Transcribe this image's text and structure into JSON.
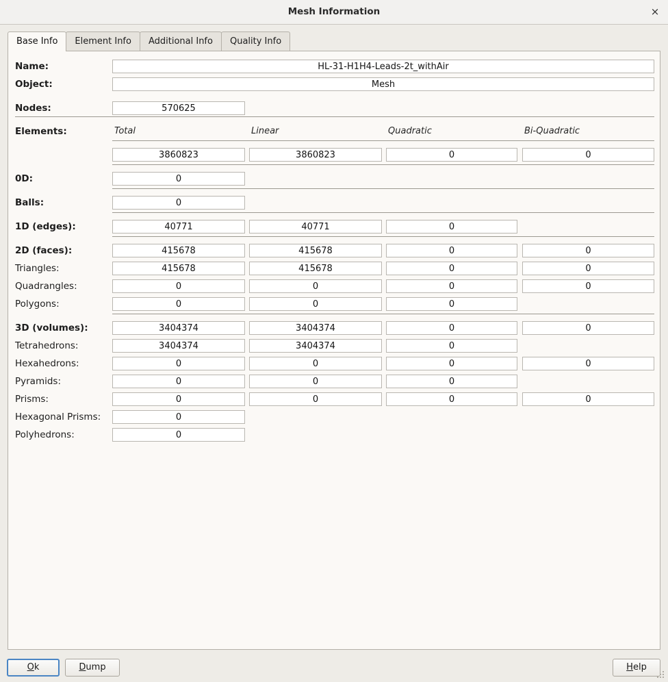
{
  "window": {
    "title": "Mesh Information",
    "close_icon": "close-icon",
    "close_glyph": "×"
  },
  "tabs": [
    {
      "label": "Base Info",
      "active": true
    },
    {
      "label": "Element Info",
      "active": false
    },
    {
      "label": "Additional Info",
      "active": false
    },
    {
      "label": "Quality Info",
      "active": false
    }
  ],
  "base_info": {
    "name_label": "Name:",
    "name_value": "HL-31-H1H4-Leads-2t_withAir",
    "object_label": "Object:",
    "object_value": "Mesh",
    "nodes_label": "Nodes:",
    "nodes_value": "570625",
    "elements_label": "Elements:",
    "columns": [
      "Total",
      "Linear",
      "Quadratic",
      "Bi-Quadratic"
    ],
    "rows": [
      {
        "label": "",
        "bold": true,
        "values": [
          "3860823",
          "3860823",
          "0",
          "0"
        ]
      },
      {
        "label": "0D:",
        "bold": true,
        "values": [
          "0",
          null,
          null,
          null
        ]
      },
      {
        "label": "Balls:",
        "bold": true,
        "values": [
          "0",
          null,
          null,
          null
        ]
      },
      {
        "label": "1D (edges):",
        "bold": true,
        "values": [
          "40771",
          "40771",
          "0",
          null
        ]
      },
      {
        "label": "2D (faces):",
        "bold": true,
        "values": [
          "415678",
          "415678",
          "0",
          "0"
        ]
      },
      {
        "label": "Triangles:",
        "bold": false,
        "values": [
          "415678",
          "415678",
          "0",
          "0"
        ]
      },
      {
        "label": "Quadrangles:",
        "bold": false,
        "values": [
          "0",
          "0",
          "0",
          "0"
        ]
      },
      {
        "label": "Polygons:",
        "bold": false,
        "values": [
          "0",
          "0",
          "0",
          null
        ]
      },
      {
        "label": "3D (volumes):",
        "bold": true,
        "values": [
          "3404374",
          "3404374",
          "0",
          "0"
        ]
      },
      {
        "label": "Tetrahedrons:",
        "bold": false,
        "values": [
          "3404374",
          "3404374",
          "0",
          null
        ]
      },
      {
        "label": "Hexahedrons:",
        "bold": false,
        "values": [
          "0",
          "0",
          "0",
          "0"
        ]
      },
      {
        "label": "Pyramids:",
        "bold": false,
        "values": [
          "0",
          "0",
          "0",
          null
        ]
      },
      {
        "label": "Prisms:",
        "bold": false,
        "values": [
          "0",
          "0",
          "0",
          "0"
        ]
      },
      {
        "label": "Hexagonal Prisms:",
        "bold": false,
        "values": [
          "0",
          null,
          null,
          null
        ]
      },
      {
        "label": "Polyhedrons:",
        "bold": false,
        "values": [
          "0",
          null,
          null,
          null
        ]
      }
    ]
  },
  "footer": {
    "ok_label": "Ok",
    "ok_mnemonic": "O",
    "ok_rest": "k",
    "dump_label": "Dump",
    "dump_mnemonic": "D",
    "dump_rest": "ump",
    "help_label": "Help",
    "help_mnemonic": "H",
    "help_rest": "elp"
  },
  "colors": {
    "window_bg": "#eeece7",
    "panel_bg": "#fbf9f6",
    "field_bg": "#ffffff",
    "field_border": "#b9b6b0",
    "separator": "#9c9991",
    "focus_blue": "#4a85c4"
  }
}
